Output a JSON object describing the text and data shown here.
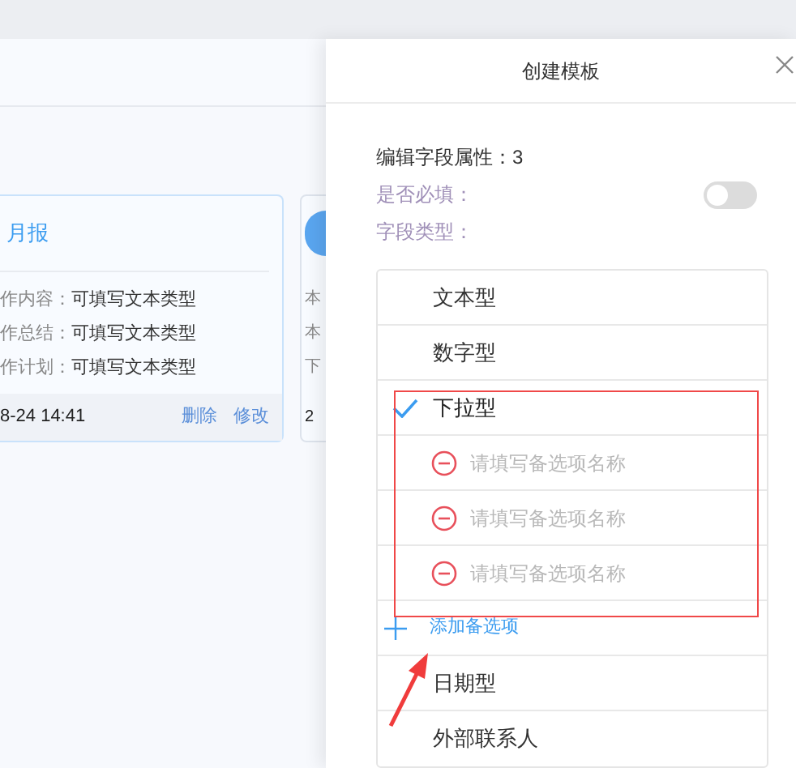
{
  "report_card": {
    "title": "月报",
    "fields": [
      {
        "label": "作内容：",
        "value": "可填写文本类型"
      },
      {
        "label": "作总结：",
        "value": "可填写文本类型"
      },
      {
        "label": "作计划：",
        "value": "可填写文本类型"
      }
    ],
    "time": "8-24 14:41",
    "actions": [
      "删除",
      "修改"
    ]
  },
  "partial_card": {
    "labels": [
      "本",
      "本",
      "下"
    ],
    "time": "2"
  },
  "drawer": {
    "title": "创建模板",
    "heading": "编辑字段属性：3",
    "required_label": "是否必填：",
    "required_on": false,
    "type_label": "字段类型：",
    "types": [
      {
        "kind": "type",
        "label": "文本型",
        "selected": false
      },
      {
        "kind": "type",
        "label": "数字型",
        "selected": false
      },
      {
        "kind": "type",
        "label": "下拉型",
        "selected": true
      },
      {
        "kind": "option",
        "placeholder": "请填写备选项名称"
      },
      {
        "kind": "option",
        "placeholder": "请填写备选项名称"
      },
      {
        "kind": "option",
        "placeholder": "请填写备选项名称"
      },
      {
        "kind": "add",
        "label": "添加备选项"
      },
      {
        "kind": "type",
        "label": "日期型",
        "selected": false
      },
      {
        "kind": "type",
        "label": "外部联系人",
        "selected": false
      }
    ]
  }
}
